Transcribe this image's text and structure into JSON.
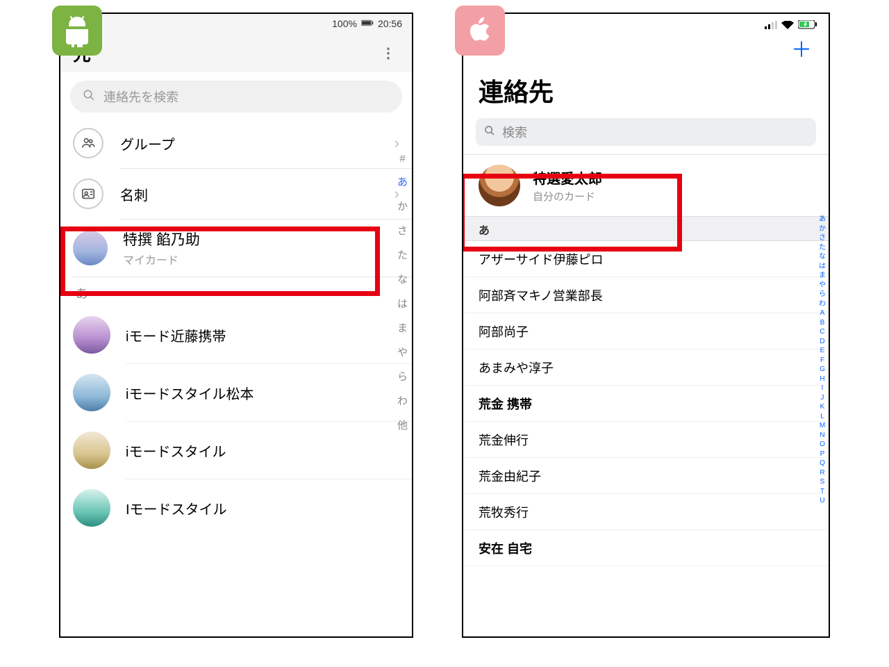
{
  "android": {
    "status": {
      "battery_pct": "100%",
      "time": "20:56"
    },
    "title": "先",
    "search_placeholder": "連絡先を検索",
    "rows": {
      "groups_label": "グループ",
      "cards_label": "名刺"
    },
    "mycard": {
      "name": "特撰 餡乃助",
      "sub": "マイカード"
    },
    "section_letter": "あ",
    "contacts": [
      "iモード近藤携帯",
      "iモードスタイル松本",
      "iモードスタイル",
      "Iモードスタイル"
    ],
    "index": [
      "#",
      "あ",
      "か",
      "さ",
      "た",
      "な",
      "は",
      "ま",
      "や",
      "ら",
      "わ",
      "他"
    ],
    "index_active": "あ"
  },
  "ios": {
    "title": "連絡先",
    "search_placeholder": "検索",
    "mycard": {
      "name": "特選愛太郎",
      "sub": "自分のカード"
    },
    "section_letter": "あ",
    "contacts": [
      {
        "t": "アザーサイド伊藤ピロ"
      },
      {
        "t": "阿部斉マキノ営業部長"
      },
      {
        "t": "阿部尚子"
      },
      {
        "t": "あまみや淳子"
      },
      {
        "t": "荒金 携帯",
        "bold": true
      },
      {
        "t": "荒金伸行"
      },
      {
        "t": "荒金由紀子"
      },
      {
        "t": "荒牧秀行"
      },
      {
        "t": "安在 自宅",
        "bold": true
      }
    ],
    "index": [
      "あ",
      "か",
      "さ",
      "た",
      "な",
      "は",
      "ま",
      "や",
      "ら",
      "わ",
      "A",
      "B",
      "C",
      "D",
      "E",
      "F",
      "G",
      "H",
      "I",
      "J",
      "K",
      "L",
      "M",
      "N",
      "O",
      "P",
      "Q",
      "R",
      "S",
      "T",
      "U"
    ]
  }
}
